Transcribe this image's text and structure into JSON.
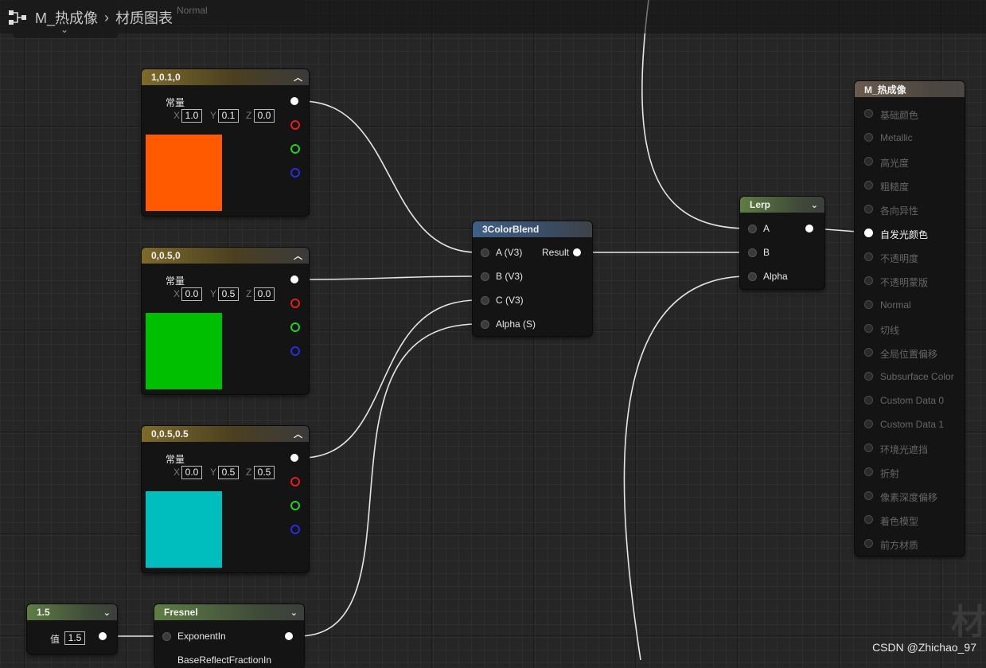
{
  "breadcrumb": {
    "asset": "M_热成像",
    "section": "材质图表",
    "ghost_text": "Normal"
  },
  "constants": [
    {
      "title": "1,0.1,0",
      "label": "常量",
      "x": "1.0",
      "y": "0.1",
      "z": "0.0",
      "color": "#FF5A00"
    },
    {
      "title": "0,0.5,0",
      "label": "常量",
      "x": "0.0",
      "y": "0.5",
      "z": "0.0",
      "color": "#00BE00"
    },
    {
      "title": "0,0.5,0.5",
      "label": "常量",
      "x": "0.0",
      "y": "0.5",
      "z": "0.5",
      "color": "#00BEBE"
    }
  ],
  "axis_labels": {
    "x": "X",
    "y": "Y",
    "z": "Z"
  },
  "blend": {
    "title": "3ColorBlend",
    "inputs": [
      "A (V3)",
      "B (V3)",
      "C (V3)",
      "Alpha (S)"
    ],
    "output": "Result"
  },
  "lerp": {
    "title": "Lerp",
    "inputs": [
      "A",
      "B",
      "Alpha"
    ]
  },
  "scalar": {
    "title": "1.5",
    "label": "值",
    "value": "1.5"
  },
  "fresnel": {
    "title": "Fresnel",
    "inputs": [
      "ExponentIn",
      "BaseReflectFractionIn"
    ]
  },
  "material": {
    "title": "M_热成像",
    "inputs": [
      {
        "label": "基础颜色",
        "active": false
      },
      {
        "label": "Metallic",
        "active": false
      },
      {
        "label": "高光度",
        "active": false
      },
      {
        "label": "粗糙度",
        "active": false
      },
      {
        "label": "各向异性",
        "active": false
      },
      {
        "label": "自发光颜色",
        "active": true
      },
      {
        "label": "不透明度",
        "active": false
      },
      {
        "label": "不透明蒙版",
        "active": false
      },
      {
        "label": "Normal",
        "active": false
      },
      {
        "label": "切线",
        "active": false
      },
      {
        "label": "全局位置偏移",
        "active": false
      },
      {
        "label": "Subsurface Color",
        "active": false
      },
      {
        "label": "Custom Data 0",
        "active": false
      },
      {
        "label": "Custom Data 1",
        "active": false
      },
      {
        "label": "环境光遮挡",
        "active": false
      },
      {
        "label": "折射",
        "active": false
      },
      {
        "label": "像素深度偏移",
        "active": false
      },
      {
        "label": "着色模型",
        "active": false
      },
      {
        "label": "前方材质",
        "active": false
      }
    ]
  },
  "watermark": "CSDN @Zhichao_97",
  "corner_glyph": "材"
}
